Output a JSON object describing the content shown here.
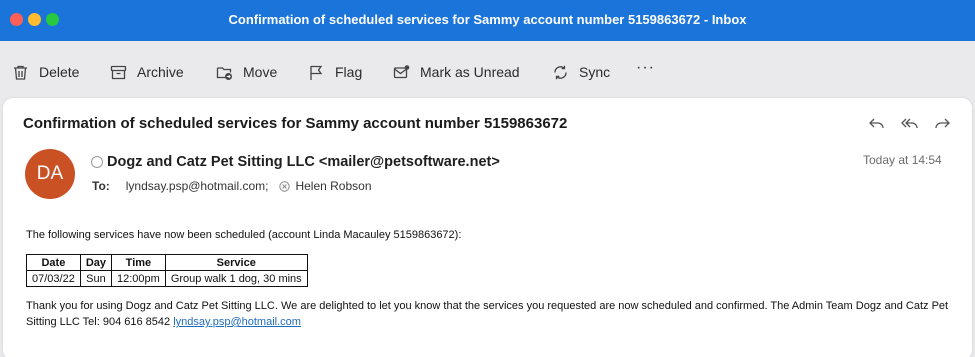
{
  "window": {
    "title": "Confirmation of scheduled services for Sammy account number 5159863672 - Inbox"
  },
  "toolbar": {
    "delete": "Delete",
    "archive": "Archive",
    "move": "Move",
    "flag": "Flag",
    "mark_unread": "Mark as Unread",
    "sync": "Sync",
    "more": "···"
  },
  "message": {
    "subject": "Confirmation of scheduled services for Sammy account number 5159863672",
    "avatar_initials": "DA",
    "avatar_color": "#c95124",
    "sender": "Dogz and Catz Pet Sitting LLC <mailer@petsoftware.net>",
    "date": "Today at 14:54",
    "to_label": "To:",
    "to_primary": "lyndsay.psp@hotmail.com;",
    "to_secondary": "Helen Robson",
    "intro": "The following services have now been scheduled (account Linda Macauley 5159863672):",
    "table": {
      "headers": [
        "Date",
        "Day",
        "Time",
        "Service"
      ],
      "rows": [
        [
          "07/03/22",
          "Sun",
          "12:00pm",
          "Group walk 1 dog, 30 mins"
        ]
      ]
    },
    "closing": "Thank you for using Dogz and Catz Pet Sitting LLC. We are delighted to let you know that the services you requested are now scheduled and confirmed. The Admin Team Dogz and Catz Pet Sitting LLC Tel: 904 616 8542 ",
    "closing_link": "lyndsay.psp@hotmail.com"
  },
  "colors": {
    "titlebar": "#1a74da",
    "link": "#1f6cbf"
  }
}
